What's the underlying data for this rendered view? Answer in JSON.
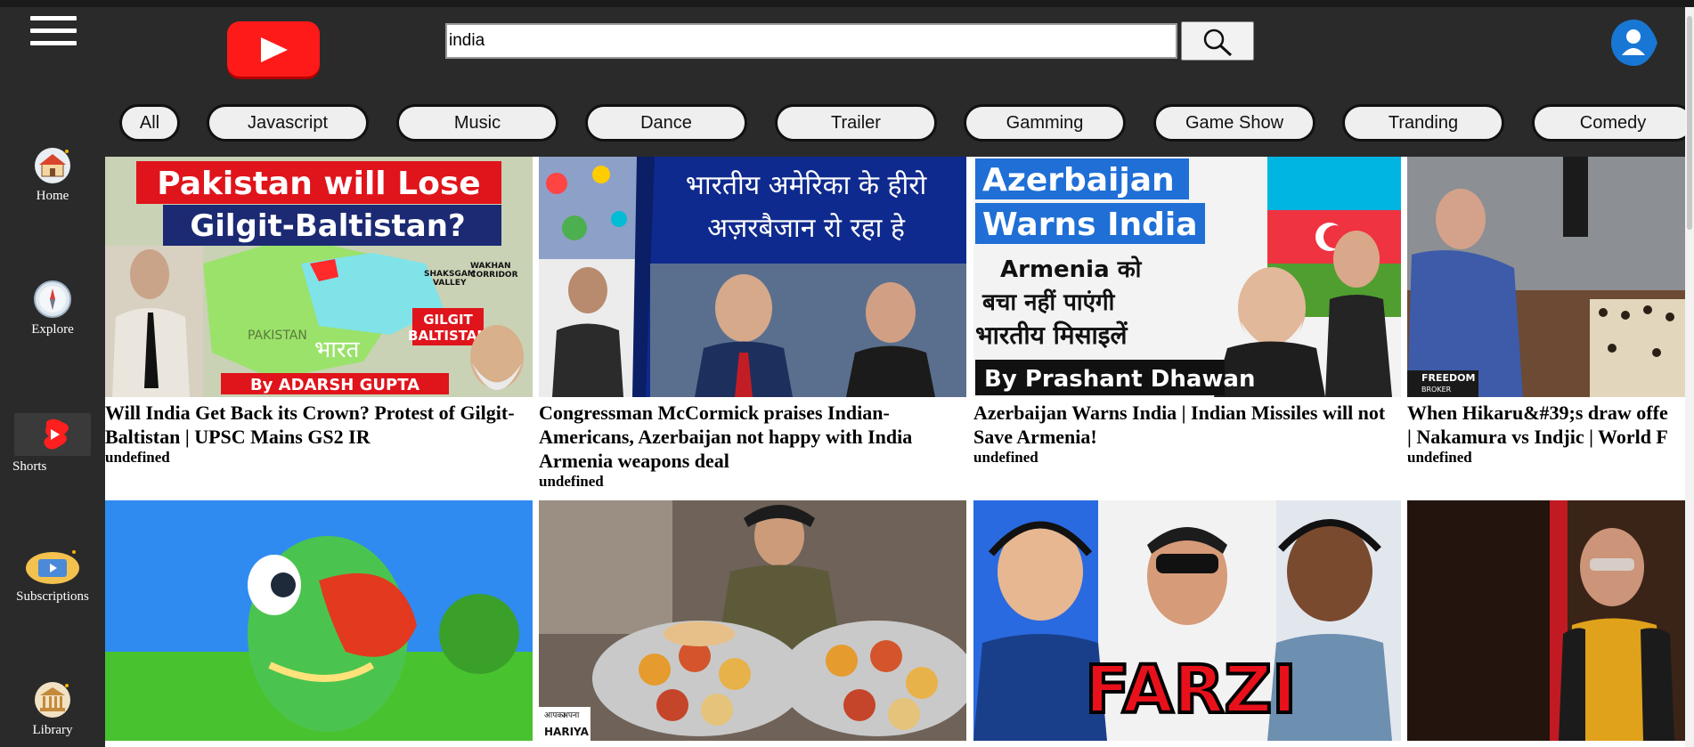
{
  "search": {
    "value": "india"
  },
  "sidebar": {
    "items": [
      {
        "label": "Home",
        "icon": "home-icon"
      },
      {
        "label": "Explore",
        "icon": "compass-icon"
      },
      {
        "label": "Shorts",
        "icon": "shorts-icon"
      },
      {
        "label": "Subscriptions",
        "icon": "subscriptions-icon"
      },
      {
        "label": "Library",
        "icon": "library-icon"
      }
    ]
  },
  "chips": [
    "All",
    "Javascript",
    "Music",
    "Dance",
    "Trailer",
    "Gamming",
    "Game Show",
    "Tranding",
    "Comedy"
  ],
  "videos": [
    {
      "title": "Will India Get Back its Crown? Protest of Gilgit-Baltistan | UPSC Mains GS2 IR",
      "sub": "undefined",
      "thumb_text": [
        "Pakistan will Lose",
        "Gilgit-Baltistan?",
        "By ADARSH GUPTA",
        "GILGIT",
        "BALTISTAN",
        "SHAKSGAM",
        "VALLEY",
        "WAKHAN",
        "CORRIDOR",
        "PAKISTAN",
        "भारत"
      ]
    },
    {
      "title": "Congressman McCormick praises Indian-Americans, Azerbaijan not happy with India Armenia weapons deal",
      "sub": "undefined",
      "thumb_text": [
        "भारतीय अमेरिका के हीरो",
        "अज़रबैजान रो रहा हे"
      ]
    },
    {
      "title": "Azerbaijan Warns India | Indian Missiles will not Save Armenia!",
      "sub": "undefined",
      "thumb_text": [
        "Azerbaijan",
        "Warns India",
        "Armenia को",
        "बचा नहीं पाएंगी",
        "भारतीय मिसाइलें",
        "By Prashant Dhawan"
      ]
    },
    {
      "title": "When Hikaru&#39;s draw offe",
      "title2": "| Nakamura vs Indjic | World F",
      "sub": "undefined",
      "thumb_text": [
        "FREEDOM",
        "BROKER"
      ]
    },
    {
      "title": "",
      "sub": "",
      "thumb_text": []
    },
    {
      "title": "",
      "sub": "",
      "thumb_text": [
        "आपका",
        "अपना",
        "HARIYA"
      ]
    },
    {
      "title": "",
      "sub": "",
      "thumb_text": [
        "FARZI"
      ]
    },
    {
      "title": "",
      "sub": "",
      "thumb_text": []
    }
  ],
  "colors": {
    "sidebar": "#2a2a2a",
    "brand_red": "#ff1a1a",
    "avatar_blue": "#1877d4"
  }
}
